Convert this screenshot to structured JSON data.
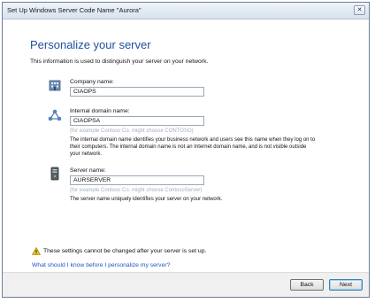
{
  "window": {
    "title": "Set Up Windows Server Code Name \"Aurora\"",
    "close_glyph": "✕"
  },
  "page": {
    "heading": "Personalize your server",
    "intro": "This information is used to distinguish your server on your network."
  },
  "company": {
    "icon": "building-icon",
    "label": "Company name:",
    "value": "CIAOPS"
  },
  "domain": {
    "icon": "network-icon",
    "label": "Internal domain name:",
    "value": "CIAOPSA",
    "hint": "(for example Contoso Co. might choose CONTOSO)",
    "desc_line1": "The internal domain name identifies your business network and users see this name when they log on to",
    "desc_line2": "their computers. The internal domain name is not an Internet domain name, and is not visible outside",
    "desc_line3": "your network."
  },
  "server": {
    "icon": "server-icon",
    "label": "Server name:",
    "value": "AURSERVER",
    "hint": "(for example Contoso Co. might choose ContosoServer)",
    "desc": "The server name uniquely identifies your server on your network."
  },
  "warning": {
    "icon": "warning-icon",
    "text": "These settings cannot be changed after your server is set up."
  },
  "help_link": "What should I know before I personalize my server?",
  "buttons": {
    "back": "Back",
    "next": "Next"
  }
}
